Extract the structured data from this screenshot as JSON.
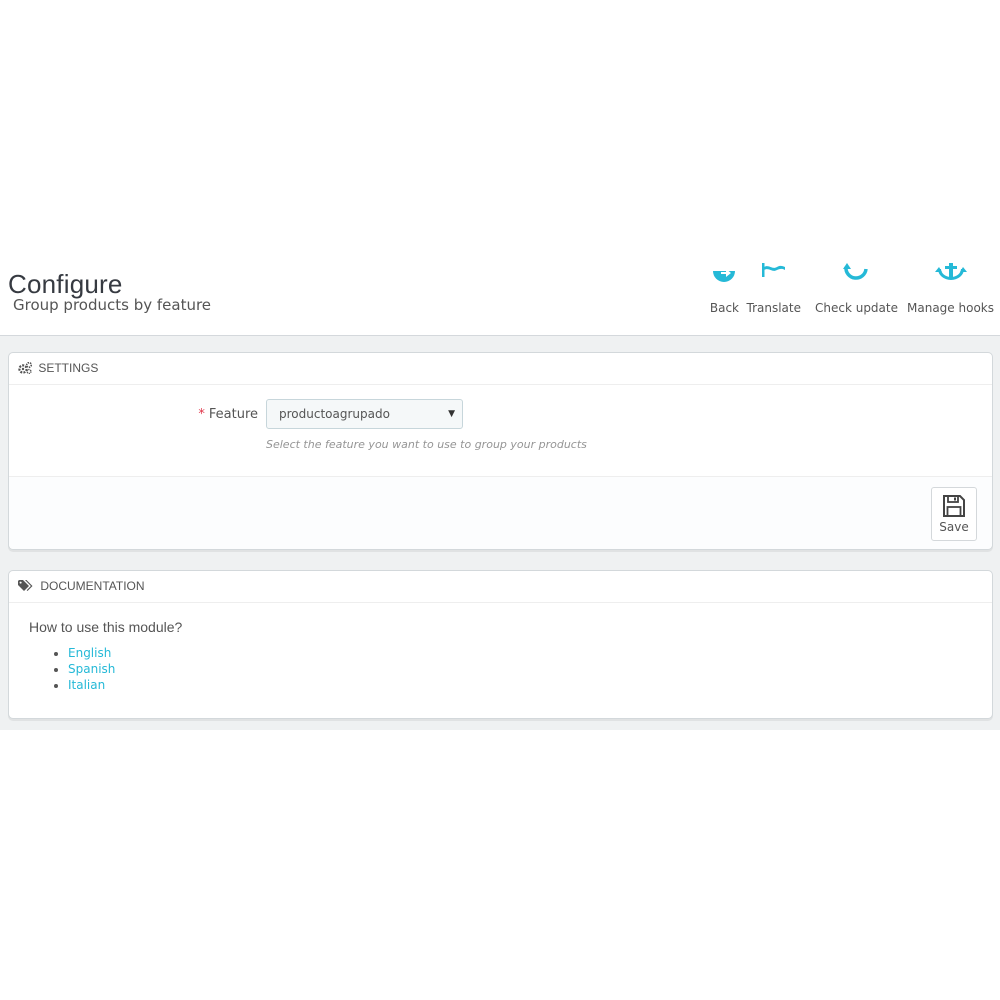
{
  "header": {
    "title": "Configure",
    "subtitle": "Group products by feature",
    "toolbar": [
      {
        "label": "Back",
        "icon": "back-icon"
      },
      {
        "label": "Translate",
        "icon": "flag-icon"
      },
      {
        "label": "Check update",
        "icon": "refresh-icon"
      },
      {
        "label": "Manage hooks",
        "icon": "anchor-icon"
      }
    ]
  },
  "settings": {
    "heading": "Settings",
    "feature_label": "Feature",
    "required_marker": "*",
    "feature_value": "productoagrupado",
    "help": "Select the feature you want to use to group your products",
    "save_label": "Save"
  },
  "documentation": {
    "heading": "Documentation",
    "question": "How to use this module?",
    "links": [
      "English",
      "Spanish",
      "Italian"
    ]
  },
  "colors": {
    "accent": "#25b9d7",
    "required": "#e0354a",
    "background": "#eff1f2"
  }
}
